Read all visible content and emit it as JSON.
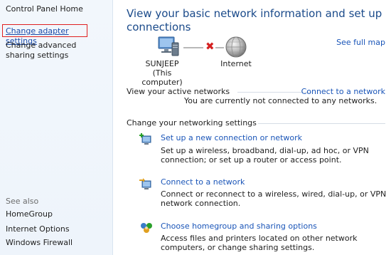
{
  "sidebar": {
    "home": "Control Panel Home",
    "adapter": "Change adapter settings",
    "advanced": "Change advanced sharing settings",
    "see_also": "See also",
    "links": [
      "HomeGroup",
      "Internet Options",
      "Windows Firewall"
    ]
  },
  "main": {
    "title": "View your basic network information and set up connections",
    "see_full_map": "See full map",
    "map": {
      "computer_name": "SUNJEEP",
      "computer_sub": "(This computer)",
      "internet": "Internet"
    },
    "active_networks": {
      "label": "View your active networks",
      "connect_link": "Connect to a network",
      "status": "You are currently not connected to any networks."
    },
    "settings": {
      "label": "Change your networking settings",
      "tasks": [
        {
          "link": "Set up a new connection or network",
          "desc": "Set up a wireless, broadband, dial-up, ad hoc, or VPN connection; or set up a router or access point.",
          "icon": "new-connection-icon"
        },
        {
          "link": "Connect to a network",
          "desc": "Connect or reconnect to a wireless, wired, dial-up, or VPN network connection.",
          "icon": "connect-network-icon"
        },
        {
          "link": "Choose homegroup and sharing options",
          "desc": "Access files and printers located on other network computers, or change sharing settings.",
          "icon": "homegroup-icon"
        }
      ]
    }
  },
  "colors": {
    "link": "#1a55b8",
    "title": "#1a4a8a",
    "highlight_border": "#e02020",
    "disconnect_x": "#d42020"
  }
}
